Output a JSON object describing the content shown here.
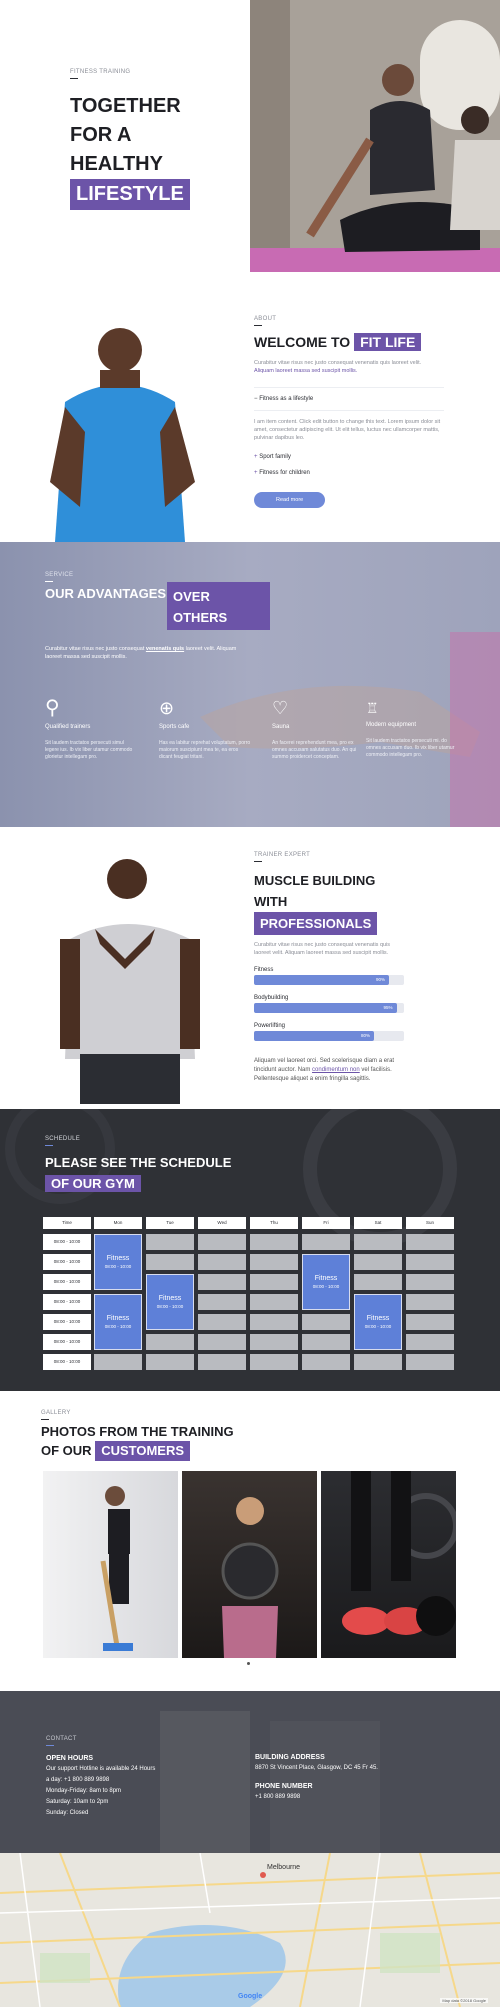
{
  "hero": {
    "eyebrow": "FITNESS TRAINING",
    "line1": "TOGETHER",
    "line2": "FOR A",
    "line3": "HEALTHY",
    "highlight": "LIFESTYLE"
  },
  "welcome": {
    "eyebrow": "ABOUT",
    "title": "WELCOME TO",
    "highlight": "FIT LIFE",
    "intro1": "Curabitur vitae risus nec justo consequat venenatis quis laoreet velit.",
    "intro2": "Aliquam laoreet massa sed suscipit mollis.",
    "acc_open": "Fitness as a lifestyle",
    "acc_body": "I am item content. Click edit button to change this text. Lorem ipsum dolor sit amet, consectetur adipiscing elit. Ut elit tellus, luctus nec ullamcorper mattis, pulvinar dapibus leo.",
    "acc2": "Sport family",
    "acc3": "Fitness for children",
    "button": "Read more"
  },
  "advantages": {
    "eyebrow": "SERVICE",
    "title": "OUR ADVANTAGES",
    "hl1": "OVER",
    "hl2": "OTHERS",
    "intro_a": "Curabitur vitae risus nec justo consequat ",
    "intro_link": "venenatis quis",
    "intro_b": " laoreet velit. Aliquam laoreet massa sed suscipit mollis.",
    "items": [
      {
        "title": "Qualified trainers",
        "text": "Sit laudem tractatos persecuti simul legere ius. Ib vix liber utamur commodo glorietur intellegam pro."
      },
      {
        "title": "Sports cafe",
        "text": "Has ea labitur reprehat voluptatum, porro maiorum suscipiunt mea te, ea eros dicant feugiat tritani."
      },
      {
        "title": "Sauna",
        "text": "An facerei reprehendunt mea, pro ex omnes accusam salutatus duo. An qui summo proidercet conceptam."
      },
      {
        "title": "Modern equipment",
        "text": "Sit laudem tractatos persecuti mi. do omnes accusam duo. Ib vix liber utamur commodo intellegam pro."
      }
    ]
  },
  "trainer": {
    "eyebrow": "TRAINER EXPERT",
    "l1": "MUSCLE BUILDING",
    "l2": "WITH",
    "highlight": "PROFESSIONALS",
    "intro1": "Curabitur vitae risus nec justo consequat venenatis quis",
    "intro2": "laoreet velit. Aliquam laoreet massa sed suscipit mollis.",
    "skills": [
      {
        "label": "Fitness",
        "value": 90,
        "pct": "90%"
      },
      {
        "label": "Bodybuilding",
        "value": 95,
        "pct": "95%"
      },
      {
        "label": "Powerlifting",
        "value": 80,
        "pct": "80%"
      }
    ],
    "footer_a": "Aliquam vel laoreet orci. Sed scelerisque diam a erat tincidunt auctor. Nam ",
    "footer_link": "condimentum non",
    "footer_b": " vel facilisis. Pellentesque aliquet a enim fringilla sagittis."
  },
  "schedule": {
    "eyebrow": "SCHEDULE",
    "title": "PLEASE SEE THE SCHEDULE",
    "highlight": "OF OUR GYM",
    "days": [
      "Time",
      "Mon",
      "Tue",
      "Wed",
      "Thu",
      "Fri",
      "Sat",
      "Sun"
    ],
    "times": [
      "08:00 - 10:00",
      "08:00 - 10:00",
      "08:00 - 10:00",
      "08:00 - 10:00",
      "08:00 - 10:00",
      "08:00 - 10:00",
      "08:00 - 10:00"
    ],
    "class_name": "Fitness",
    "class_time": "08:00 - 10:00"
  },
  "gallery": {
    "eyebrow": "GALLERY",
    "l1": "PHOTOS FROM THE TRAINING",
    "l2": "OF OUR",
    "highlight": "CUSTOMERS"
  },
  "contact": {
    "eyebrow": "CONTACT",
    "hours_title": "OPEN HOURS",
    "hours": [
      "Our support Hotline is available 24 Hours",
      "a day: +1 800 889 9898",
      "Monday-Friday: 8am to 8pm",
      "Saturday: 10am to 2pm",
      "Sunday: Closed"
    ],
    "addr_title": "BUILDING ADDRESS",
    "addr": "8870 St Vincent Place, Glasgow, DC 45 Fr 45.",
    "phone_title": "PHONE NUMBER",
    "phone": "+1 800 889 9898"
  },
  "map": {
    "city": "Melbourne",
    "credit": "Map data ©2018 Google",
    "brand": "Google"
  },
  "colors": {
    "accent": "#6c54a8",
    "blue": "#6f89d8",
    "dark": "#2f3136"
  }
}
